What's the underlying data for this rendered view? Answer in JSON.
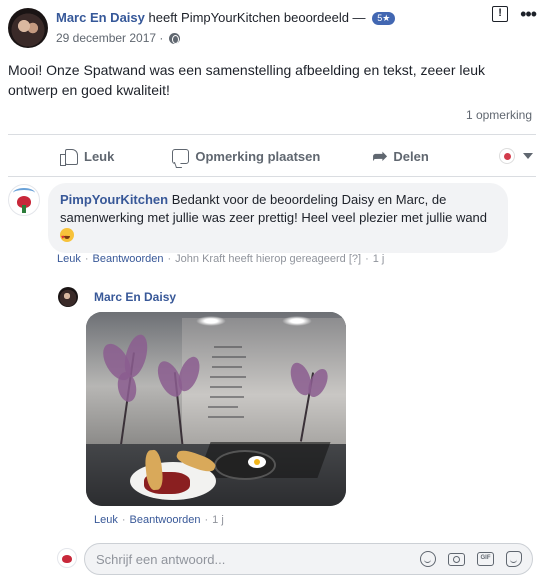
{
  "post": {
    "author": "Marc En Daisy",
    "action": "heeft PimpYourKitchen beoordeeld —",
    "rating_badge": "5★",
    "date": "29 december 2017 ·",
    "text": "Mooi! Onze Spatwand was een samenstelling afbeelding en tekst, zeeer leuk ontwerp en goed kwaliteit!",
    "comment_count": "1 opmerking"
  },
  "actions": {
    "like": "Leuk",
    "comment": "Opmerking plaatsen",
    "share": "Delen"
  },
  "comment": {
    "author": "PimpYourKitchen",
    "text": "Bedankt voor de beoordeling Daisy en Marc, de samenwerking met jullie was zeer prettig! Heel veel plezier met jullie wand",
    "like": "Leuk",
    "reply": "Beantwoorden",
    "replied_note": "John Kraft heeft hierop gereageerd",
    "help_mark": "[?]",
    "time": "1 j"
  },
  "reply": {
    "author": "Marc En Daisy",
    "like": "Leuk",
    "reply": "Beantwoorden",
    "time": "1 j"
  },
  "reply_input": {
    "placeholder": "Schrijf een antwoord..."
  },
  "icons": {
    "report": "report-icon",
    "more": "more-icon",
    "like": "like-icon",
    "comment": "comment-icon",
    "share": "share-icon",
    "emoji": "heart-eyes-emoji",
    "gif_label": "GIF"
  },
  "colors": {
    "link": "#385898",
    "secondary_text": "#606770",
    "bubble": "#f2f3f5"
  }
}
